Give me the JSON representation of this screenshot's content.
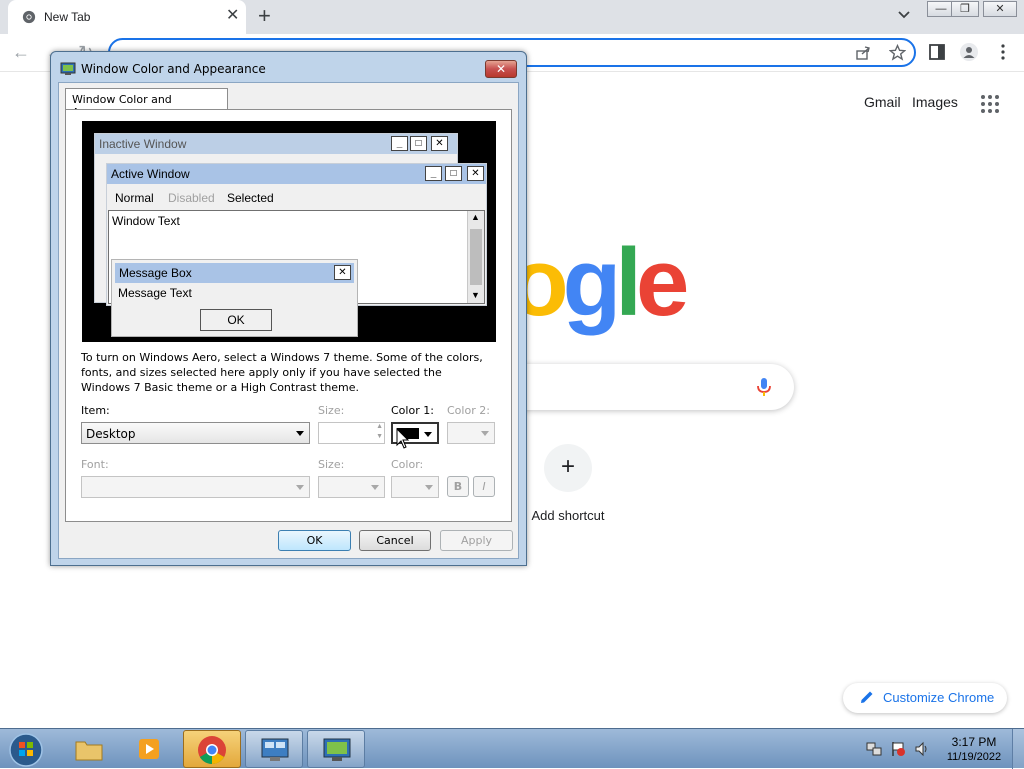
{
  "browser": {
    "tab_title": "New Tab",
    "ntp": {
      "gmail": "Gmail",
      "images": "Images",
      "logo_visible": "ogle",
      "add_shortcut": "Add shortcut",
      "customize": "Customize Chrome"
    }
  },
  "dialog": {
    "title": "Window Color and Appearance",
    "tab": "Window Color and Appearance",
    "preview": {
      "inactive_title": "Inactive Window",
      "active_title": "Active Window",
      "menu_normal": "Normal",
      "menu_disabled": "Disabled",
      "menu_selected": "Selected",
      "window_text": "Window Text",
      "message_box_title": "Message Box",
      "message_text": "Message Text",
      "ok": "OK"
    },
    "description": "To turn on Windows Aero, select a Windows 7 theme.  Some of the colors, fonts, and sizes selected here apply only if you have selected the Windows 7 Basic theme or a High Contrast theme.",
    "item_label": "Item:",
    "item_value": "Desktop",
    "size_label": "Size:",
    "color1_label": "Color 1:",
    "color1_value": "#000000",
    "color2_label": "Color 2:",
    "font_label": "Font:",
    "font_size_label": "Size:",
    "font_color_label": "Color:",
    "bold_label": "B",
    "italic_label": "I",
    "ok": "OK",
    "cancel": "Cancel",
    "apply": "Apply"
  },
  "taskbar": {
    "time": "3:17 PM",
    "date": "11/19/2022"
  },
  "colors": {
    "accent": "#1a73e8",
    "google_blue": "#4285f4",
    "google_red": "#ea4335",
    "google_yellow": "#fbbc05",
    "google_green": "#34a853"
  }
}
